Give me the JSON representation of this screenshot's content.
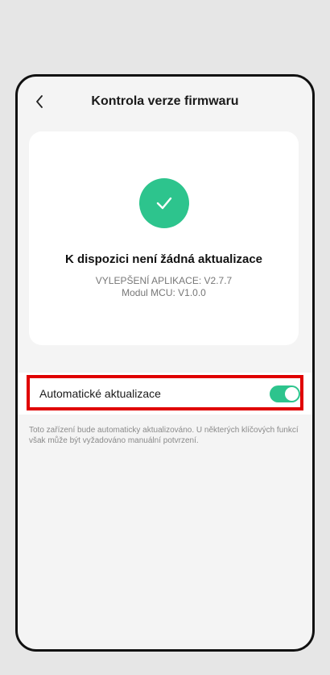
{
  "header": {
    "title": "Kontrola verze firmwaru",
    "back_icon": "chevron-left-icon"
  },
  "status": {
    "icon": "check-icon",
    "accent_color": "#2dc48d",
    "title": "K dispozici není žádná aktualizace",
    "app_version": "VYLEPŠENÍ APLIKACE: V2.7.7",
    "mcu_version": "Modul MCU: V1.0.0"
  },
  "auto_update": {
    "label": "Automatické aktualizace",
    "enabled": true,
    "highlight_color": "#e00000"
  },
  "description": "Toto zařízení bude automaticky aktualizováno. U některých klíčových funkcí však může být vyžadováno manuální potvrzení."
}
